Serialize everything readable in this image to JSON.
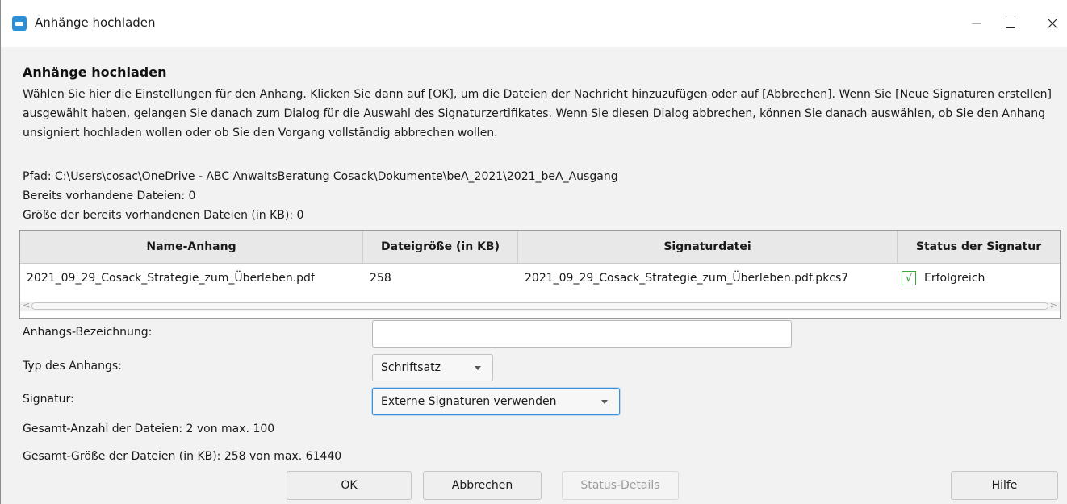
{
  "window": {
    "title": "Anhänge hochladen"
  },
  "dialog": {
    "heading": "Anhänge hochladen",
    "description": "Wählen Sie hier die Einstellungen für den Anhang. Klicken Sie dann auf [OK], um die Dateien der Nachricht hinzuzufügen oder auf [Abbrechen]. Wenn Sie [Neue Signaturen erstellen] ausgewählt haben, gelangen Sie danach zum Dialog für die Auswahl des Signaturzertifikates. Wenn Sie diesen Dialog abbrechen, können Sie danach auswählen, ob Sie den Anhang unsigniert hochladen wollen oder ob Sie den Vorgang vollständig abbrechen wollen.",
    "path": "Pfad: C:\\Users\\cosac\\OneDrive - ABC AnwaltsBeratung Cosack\\Dokumente\\beA_2021\\2021_beA_Ausgang",
    "existing_files": "Bereits vorhandene Dateien: 0",
    "existing_size": "Größe der bereits vorhandenen Dateien (in KB): 0"
  },
  "table": {
    "headers": [
      "Name-Anhang",
      "Dateigröße (in KB)",
      "Signaturdatei",
      "Status der Signatur"
    ],
    "rows": [
      {
        "name": "2021_09_29_Cosack_Strategie_zum_Überleben.pdf",
        "size": "258",
        "signature_file": "2021_09_29_Cosack_Strategie_zum_Überleben.pdf.pkcs7",
        "status": "Erfolgreich",
        "status_icon": "checkmark-icon"
      }
    ]
  },
  "form": {
    "label_bezeichnung": "Anhangs-Bezeichnung:",
    "bezeichnung_value": "",
    "label_typ": "Typ des Anhangs:",
    "typ_value": "Schriftsatz",
    "label_signatur": "Signatur:",
    "signatur_value": "Externe Signaturen verwenden"
  },
  "totals": {
    "count": "Gesamt-Anzahl der Dateien: 2 von max. 100",
    "size": "Gesamt-Größe der Dateien (in KB): 258 von max. 61440"
  },
  "buttons": {
    "ok": "OK",
    "cancel": "Abbrechen",
    "status_details": "Status-Details",
    "help": "Hilfe"
  },
  "colors": {
    "accent": "#3e8fd8",
    "success": "#2f9a2f",
    "app_icon": "#2b8fd6"
  }
}
